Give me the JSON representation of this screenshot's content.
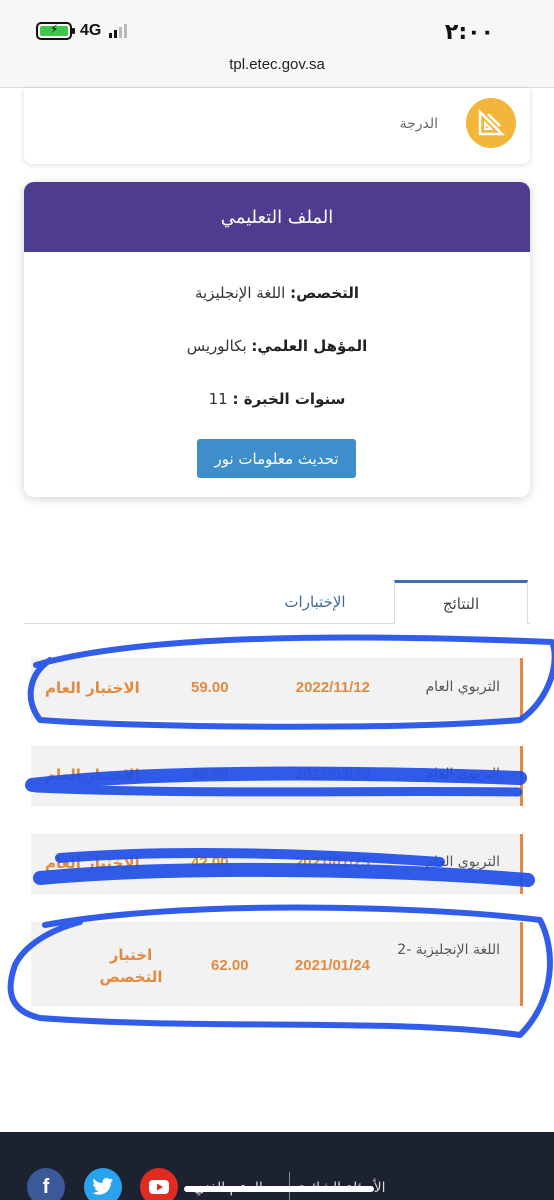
{
  "status_bar": {
    "time": "٢:٠٠",
    "network": "4G",
    "url": "tpl.etec.gov.sa",
    "colors": {
      "battery": "#3fc64b"
    }
  },
  "degree_card": {
    "label": "الدرجة",
    "icon": "ruler-triangle-icon",
    "icon_color": "#f2b63a"
  },
  "profile": {
    "title": "الملف التعليمي",
    "major_label": "التخصص:",
    "major_value": "اللغة الإنجليزية",
    "qualification_label": "المؤهل العلمي:",
    "qualification_value": "بكالوريس",
    "experience_label": "سنوات الخبرة :",
    "experience_value": "11",
    "update_button": "تحديث معلومات نور",
    "colors": {
      "header": "#4e3d8e",
      "button": "#3d8ecb"
    }
  },
  "tabs": {
    "results": "النتائج",
    "exams": "الإختبارات"
  },
  "results": [
    {
      "subject": "التربوي العام",
      "date": "2022/11/12",
      "score": "59.00",
      "type": "الاختبار العام"
    },
    {
      "subject": "التربوي العام",
      "date": "2021/03/20",
      "score": "48.00",
      "type": "الاختبار العام"
    },
    {
      "subject": "التربوي العام",
      "date": "2021/01/25",
      "score": "42.00",
      "type": "الاختبار العام"
    },
    {
      "subject": "اللغة الإنجليزية -2",
      "date": "2021/01/24",
      "score": "62.00",
      "type": "اختبار التخصص"
    }
  ],
  "footer": {
    "faq": "الأسئلة الشائعة",
    "support": "الدعم الفني",
    "social": {
      "facebook": "f",
      "twitter": "twitter-bird-icon",
      "youtube": "youtube-play-icon"
    }
  },
  "accent_color": "#e38a3f"
}
